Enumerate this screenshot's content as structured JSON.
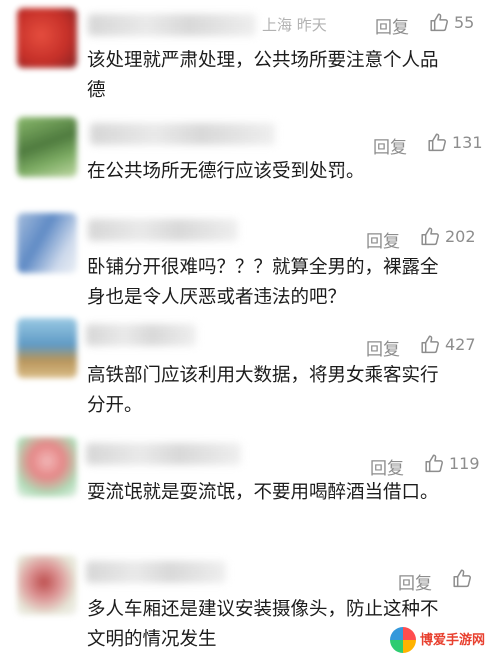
{
  "comments": [
    {
      "location_time": "上海  昨天",
      "reply_label": "回复",
      "likes": "55",
      "text": "该处理就严肃处理，公共场所要注意个人品\n德",
      "avatar_colors": [
        "#d8251c",
        "#a01212"
      ]
    },
    {
      "reply_label": "回复",
      "likes": "131",
      "text": "在公共场所无德行应该受到处罚。",
      "avatar_colors": [
        "#3f7a2e",
        "#9bc47b"
      ]
    },
    {
      "reply_label": "回复",
      "likes": "202",
      "text": "卧铺分开很难吗？？？就算全男的，裸露全\n身也是令人厌恶或者违法的吧？",
      "avatar_colors": [
        "#5a88c8",
        "#cfd9e8"
      ]
    },
    {
      "reply_label": "回复",
      "likes": "427",
      "text": "高铁部门应该利用大数据，将男女乘客实行\n分开。",
      "avatar_colors": [
        "#5aa0c8",
        "#c6a060"
      ]
    },
    {
      "reply_label": "回复",
      "likes": "119",
      "text": "耍流氓就是耍流氓，不要用喝醉酒当借口。",
      "avatar_colors": [
        "#e98a8a",
        "#9ad0a0"
      ]
    },
    {
      "reply_label": "回复",
      "likes": "",
      "text": "多人车厢还是建议安装摄像头，防止这种不\n文明的情况发生",
      "avatar_colors": [
        "#c85a5a",
        "#d8d8c8"
      ]
    }
  ],
  "watermark": {
    "main": "博爱手游网"
  },
  "icons": {
    "like": "thumbs-up-icon"
  },
  "colors": {
    "meta": "#8d8d8d",
    "text": "#1c1c1c"
  }
}
